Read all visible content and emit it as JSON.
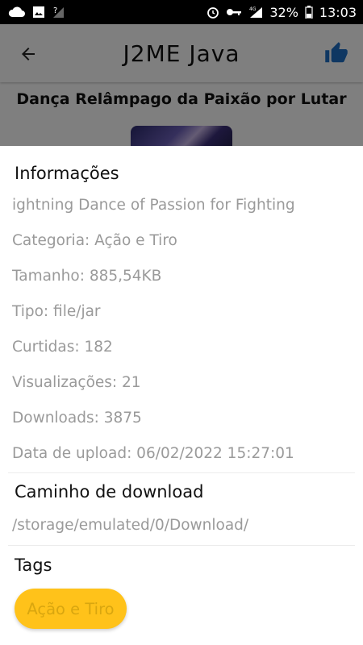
{
  "status_bar": {
    "icons_left": [
      "cloud-icon",
      "image-icon",
      "no-signal-icon"
    ],
    "icons_right": [
      "alarm-icon",
      "key-icon",
      "4g-signal-icon",
      "battery-icon"
    ],
    "battery": "32%",
    "time": "13:03"
  },
  "app_bar": {
    "title": "J2ME Java",
    "back_icon": "arrow-back-icon",
    "like_icon": "thumb-up-icon",
    "accent_color": "#1e6fc4"
  },
  "game": {
    "title": "Dança Relâmpago da Paixão por Lutar"
  },
  "info_sheet": {
    "info_title": "Informações",
    "lines": [
      "ightning Dance of Passion for Fighting",
      "Categoria: Ação e Tiro",
      "Tamanho: 885,54KB",
      "Tipo: file/jar",
      "Curtidas: 182",
      "Visualizações: 21",
      "Downloads: 3875",
      "Data de upload: 06/02/2022 15:27:01"
    ],
    "download_title": "Caminho de download",
    "download_path": "/storage/emulated/0/Download/",
    "tags_title": "Tags",
    "tags": [
      "Ação e Tiro"
    ],
    "tag_color": "#ffc21a"
  }
}
